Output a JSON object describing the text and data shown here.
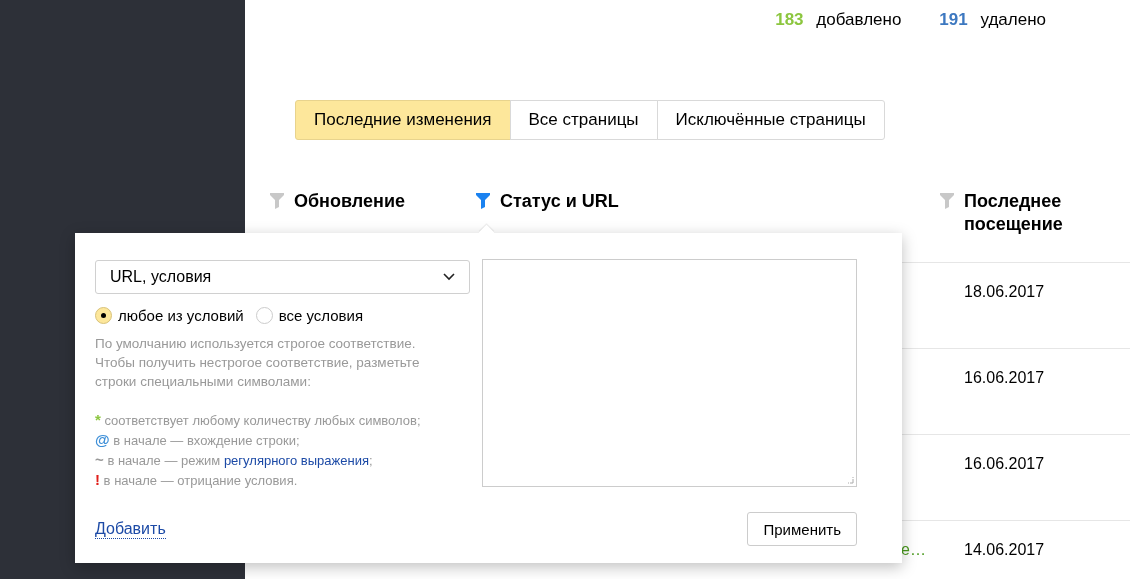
{
  "stats": [
    {
      "count": "183",
      "label": "добавлено",
      "color": "#8cc63f"
    },
    {
      "count": "191",
      "label": "удалено",
      "color": "#3d78c0"
    }
  ],
  "tabs": [
    {
      "label": "Последние изменения",
      "selected": true
    },
    {
      "label": "Все страницы",
      "selected": false
    },
    {
      "label": "Исключённые страницы",
      "selected": false
    }
  ],
  "table": {
    "columns": [
      {
        "label": "Обновление",
        "filter_active": false
      },
      {
        "label": "Статус и URL",
        "filter_active": true
      },
      {
        "label": "Последнее посещение",
        "filter_active": false
      }
    ],
    "rows": [
      {
        "status_url": "",
        "last_visit": "18.06.2017"
      },
      {
        "status_url": "",
        "last_visit": "16.06.2017"
      },
      {
        "status_url": "",
        "last_visit": "16.06.2017"
      },
      {
        "status_url": "е…",
        "last_visit": "14.06.2017"
      }
    ]
  },
  "filter_popup": {
    "field_select": {
      "value": "URL, условия"
    },
    "match_options": [
      {
        "label": "любое из условий",
        "selected": true
      },
      {
        "label": "все условия",
        "selected": false
      }
    ],
    "hint": "По умолчанию используется строгое соответствие. Чтобы получить нестрогое соответствие, разметьте строки специальными символами:",
    "rules": [
      {
        "symbol": "*",
        "color": "#8cc63f",
        "text": " соответствует любому количеству любых символов;"
      },
      {
        "symbol": "@",
        "color": "#3d8fd8",
        "text": " в начале — вхождение строки;"
      },
      {
        "symbol": "~",
        "color": "#999999",
        "text": " в начале — режим ",
        "link": "регулярного выражения",
        "after": ";"
      },
      {
        "symbol": "!",
        "color": "#e0201b",
        "text": " в начале — отрицание условия."
      }
    ],
    "add_link": "Добавить",
    "apply_button": "Применить"
  }
}
